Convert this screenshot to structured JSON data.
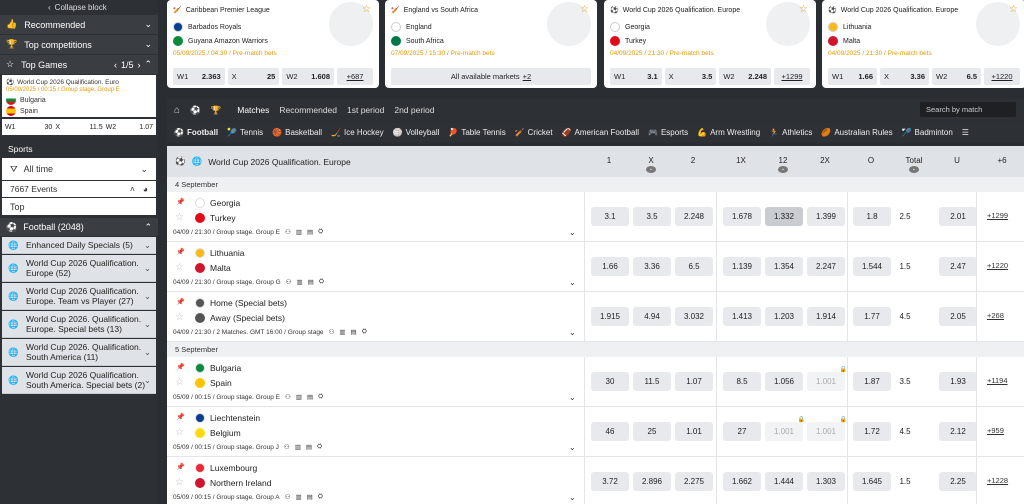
{
  "sidebar": {
    "collapse_label": "Collapse block",
    "recommended": "Recommended",
    "top_competitions": "Top competitions",
    "top_games": "Top Games",
    "top_games_pager": "1/5",
    "game_card": {
      "league": "World Cup 2026 Qualification. Euro",
      "meta": "05/09/2025 / 00:15 / Group stage. Group E",
      "team1": "Bulgaria",
      "team2": "Spain",
      "odds": [
        {
          "label": "W1",
          "value": "30"
        },
        {
          "label": "X",
          "value": "11.5"
        },
        {
          "label": "W2",
          "value": "1.07"
        }
      ]
    },
    "sports_label": "Sports",
    "time_filter": "All time",
    "events_count": "7667 Events",
    "top_label": "Top",
    "football_label": "Football (2048)",
    "categories": [
      "Enhanced Daily Specials (5)",
      "World Cup 2026 Qualification. Europe (52)",
      "World Cup 2026 Qualification. Europe. Team vs Player (27)",
      "World Cup 2026. Qualification. Europe. Special bets (13)",
      "World Cup 2026. Qualification. South America (11)",
      "World Cup 2026 Qualification. South America. Special bets (2)"
    ]
  },
  "top_cards": [
    {
      "league": "Caribbean Premier League",
      "team1": "Barbados Royals",
      "team2": "Guyana Amazon Warriors",
      "meta": "05/09/2025 / 04:30 / Pre-match bets",
      "odds": [
        {
          "l": "W1",
          "v": "2.363"
        },
        {
          "l": "X",
          "v": "25"
        },
        {
          "l": "W2",
          "v": "1.608"
        }
      ],
      "more": "+687"
    },
    {
      "league": "England vs South Africa",
      "team1": "England",
      "team2": "South Africa",
      "meta": "07/09/2025 / 15:30 / Pre-match bets",
      "all_markets": "All available markets",
      "more": "+2"
    },
    {
      "league": "World Cup 2026 Qualification. Europe",
      "team1": "Georgia",
      "team2": "Turkey",
      "meta": "04/09/2025 / 21:30 / Pre-match bets",
      "odds": [
        {
          "l": "W1",
          "v": "3.1"
        },
        {
          "l": "X",
          "v": "3.5"
        },
        {
          "l": "W2",
          "v": "2.248"
        }
      ],
      "more": "+1299"
    },
    {
      "league": "World Cup 2026 Qualification. Europe",
      "team1": "Lithuania",
      "team2": "Malta",
      "meta": "04/09/2025 / 21:30 / Pre-match bets",
      "odds": [
        {
          "l": "W1",
          "v": "1.66"
        },
        {
          "l": "X",
          "v": "3.36"
        },
        {
          "l": "W2",
          "v": "6.5"
        }
      ],
      "more": "+1220"
    }
  ],
  "nav": {
    "tabs": [
      "Matches",
      "Recommended",
      "1st period",
      "2nd period"
    ],
    "search_placeholder": "Search by match"
  },
  "sports": [
    "Football",
    "Tennis",
    "Basketball",
    "Ice Hockey",
    "Volleyball",
    "Table Tennis",
    "Cricket",
    "American Football",
    "Esports",
    "Arm Wrestling",
    "Athletics",
    "Australian Rules",
    "Badminton"
  ],
  "championship": {
    "title": "World Cup 2026 Qualification. Europe",
    "columns": [
      "1",
      "X",
      "2",
      "1X",
      "12",
      "2X",
      "O",
      "Total",
      "U",
      "+6"
    ]
  },
  "dates": [
    "4 September",
    "5 September"
  ],
  "events": [
    {
      "team1": "Georgia",
      "team2": "Turkey",
      "info": "04/09 / 21:30 / Group stage. Group E",
      "odds": [
        "3.1",
        "3.5",
        "2.248",
        "1.678",
        "1.332",
        "1.399",
        "1.8",
        "2.5",
        "2.01"
      ],
      "more": "+1299"
    },
    {
      "team1": "Lithuania",
      "team2": "Malta",
      "info": "04/09 / 21:30 / Group stage. Group G",
      "odds": [
        "1.66",
        "3.36",
        "6.5",
        "1.139",
        "1.354",
        "2.247",
        "1.544",
        "1.5",
        "2.47"
      ],
      "more": "+1220"
    },
    {
      "team1": "Home (Special bets)",
      "team2": "Away (Special bets)",
      "info": "04/09 / 21:30 / 2 Matches. GMT 16:00 / Group stage",
      "odds": [
        "1.915",
        "4.94",
        "3.032",
        "1.413",
        "1.203",
        "1.914",
        "1.77",
        "4.5",
        "2.05"
      ],
      "more": "+268"
    },
    {
      "team1": "Bulgaria",
      "team2": "Spain",
      "info": "05/09 / 00:15 / Group stage. Group E",
      "odds": [
        "30",
        "11.5",
        "1.07",
        "8.5",
        "1.056",
        "1.001",
        "1.87",
        "3.5",
        "1.93"
      ],
      "more": "+1194"
    },
    {
      "team1": "Liechtenstein",
      "team2": "Belgium",
      "info": "05/09 / 00:15 / Group stage. Group J",
      "odds": [
        "46",
        "25",
        "1.01",
        "27",
        "1.001",
        "1.001",
        "1.72",
        "4.5",
        "2.12"
      ],
      "more": "+959"
    },
    {
      "team1": "Luxembourg",
      "team2": "Northern Ireland",
      "info": "05/09 / 00:15 / Group stage. Group A",
      "odds": [
        "3.72",
        "2.896",
        "2.275",
        "1.662",
        "1.444",
        "1.303",
        "1.645",
        "1.5",
        "2.25"
      ],
      "more": "+1228"
    }
  ],
  "colors": {
    "accent": "#e39a00",
    "dark": "#2d3035",
    "panel": "#dfe2e6"
  }
}
